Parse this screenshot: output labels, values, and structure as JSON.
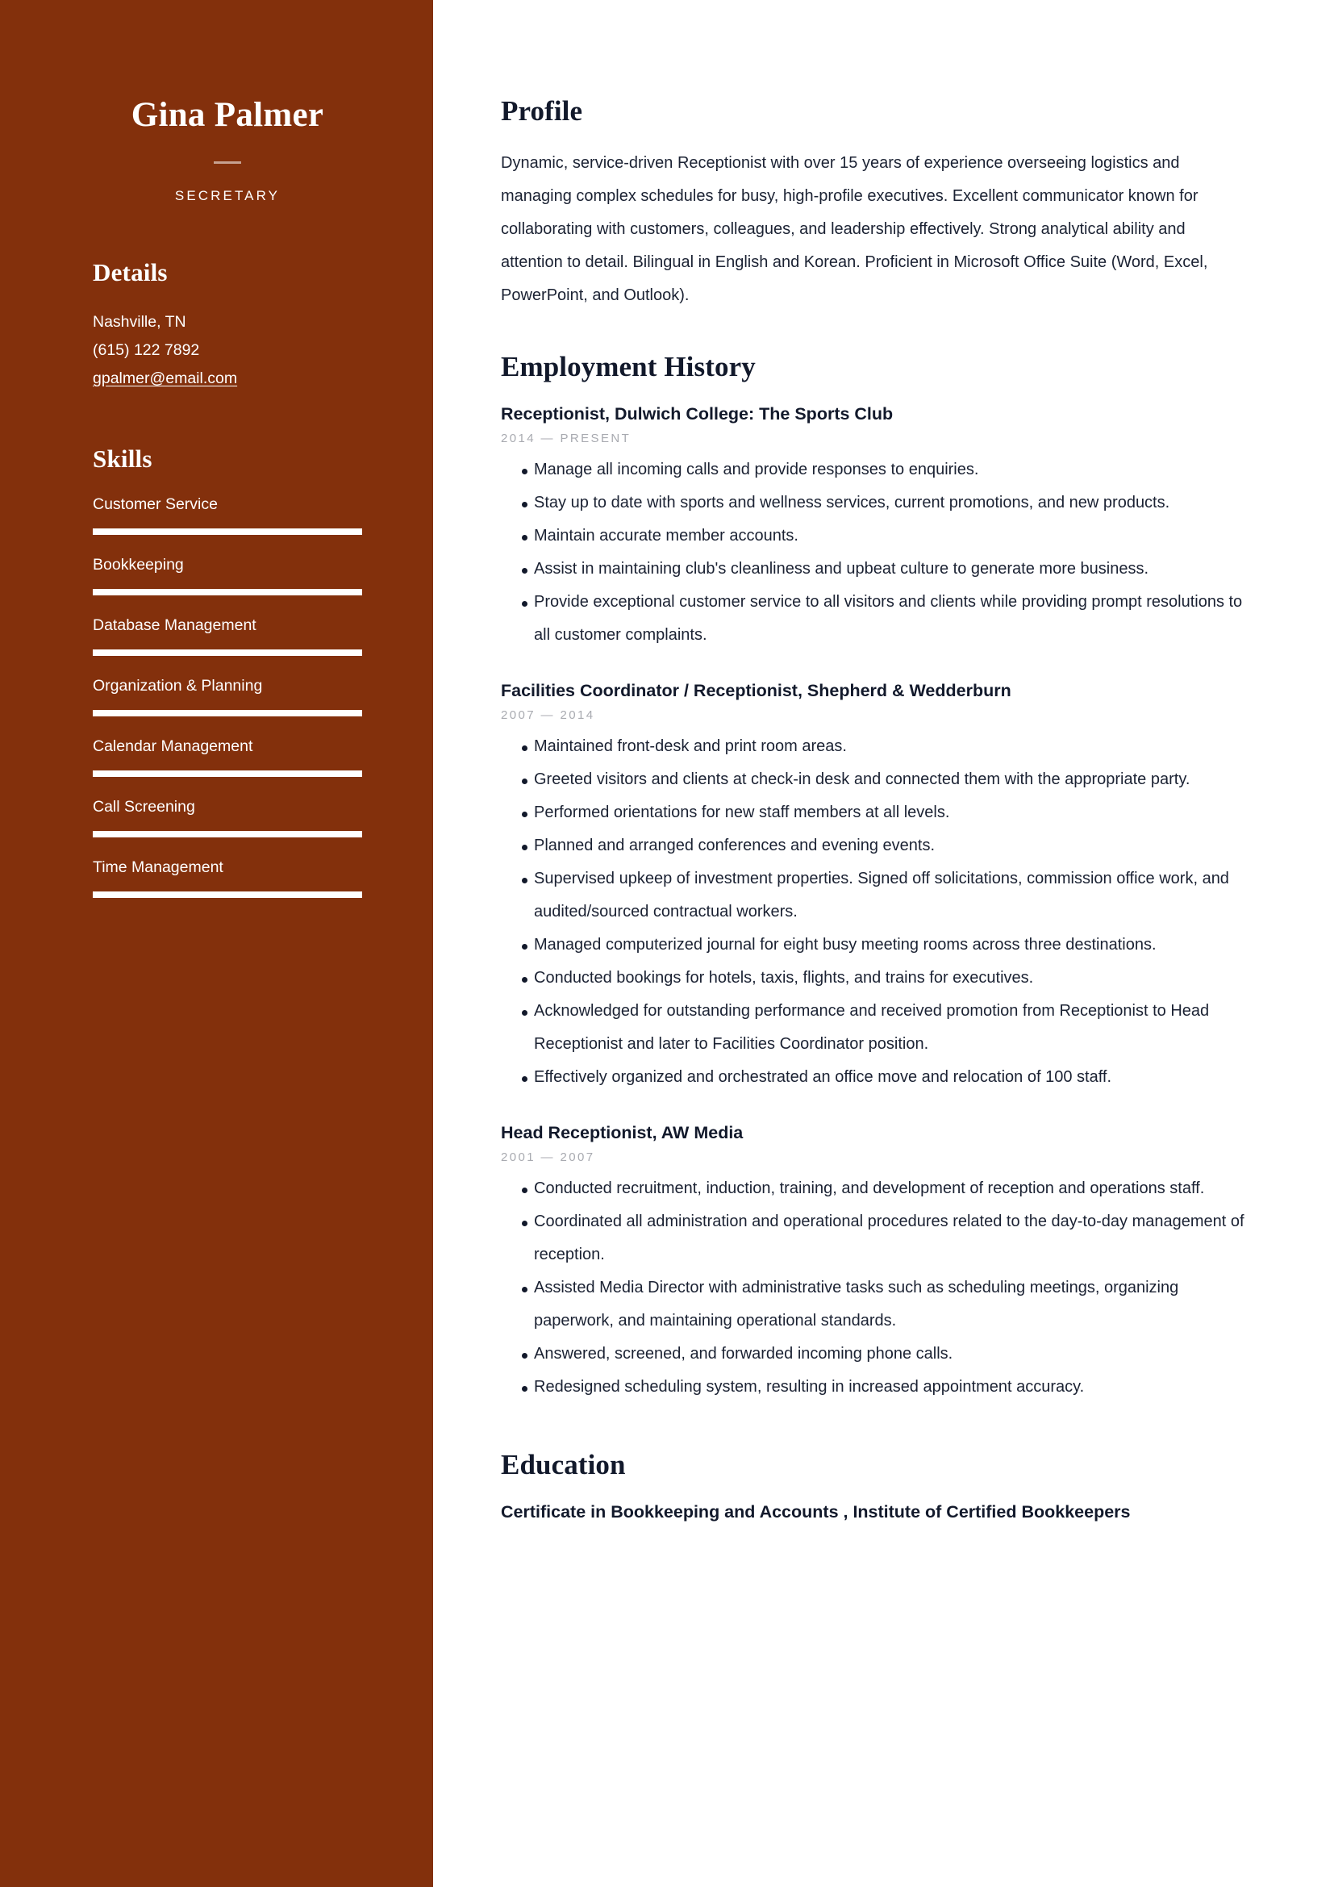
{
  "theme": {
    "sidebar_bg": "#83300C",
    "sidebar_text": "#FFFFFF",
    "main_text": "#12192B",
    "date_text": "#A8AAB0"
  },
  "sidebar": {
    "full_name": "Gina Palmer",
    "job_title": "SECRETARY",
    "details": {
      "heading": "Details",
      "lines": [
        {
          "text": "Nashville, TN",
          "is_link": false
        },
        {
          "text": "(615) 122 7892",
          "is_link": false
        },
        {
          "text": "gpalmer@email.com",
          "is_link": true
        }
      ]
    },
    "skills": {
      "heading": "Skills",
      "items": [
        {
          "label": "Customer Service",
          "level": 100
        },
        {
          "label": "Bookkeeping",
          "level": 100
        },
        {
          "label": "Database Management",
          "level": 100
        },
        {
          "label": "Organization & Planning",
          "level": 100
        },
        {
          "label": "Calendar Management",
          "level": 100
        },
        {
          "label": "Call Screening",
          "level": 100
        },
        {
          "label": "Time Management",
          "level": 100
        }
      ]
    }
  },
  "main": {
    "profile": {
      "heading": "Profile",
      "text": "Dynamic, service-driven Receptionist with over 15 years of experience overseeing logistics and managing complex schedules for busy, high-profile executives. Excellent communicator known for collaborating with customers, colleagues, and leadership effectively. Strong analytical ability and attention to detail. Bilingual in English and Korean. Proficient in Microsoft Office Suite (Word, Excel, PowerPoint, and Outlook)."
    },
    "employment": {
      "heading": "Employment History",
      "jobs": [
        {
          "title": "Receptionist, Dulwich College: The Sports Club",
          "dates": "2014 — PRESENT",
          "bullets": [
            "Manage all incoming calls and provide responses to enquiries.",
            "Stay up to date with sports and wellness services, current promotions, and new products.",
            "Maintain accurate member accounts.",
            "Assist in maintaining club's cleanliness and upbeat culture to generate more business.",
            "Provide exceptional customer service to all visitors and clients while providing prompt resolutions to all customer complaints."
          ]
        },
        {
          "title": "Facilities Coordinator / Receptionist, Shepherd & Wedderburn",
          "dates": "2007 — 2014",
          "bullets": [
            "Maintained front-desk and print room areas.",
            "Greeted visitors and clients at check-in desk and connected them with the appropriate party.",
            "Performed orientations for new staff members at all levels.",
            "Planned and arranged conferences and evening events.",
            "Supervised upkeep of investment properties. Signed off solicitations, commission office work, and audited/sourced contractual workers.",
            "Managed computerized journal for eight busy meeting rooms across three destinations.",
            "Conducted bookings for hotels, taxis, flights, and trains for executives.",
            "Acknowledged for outstanding performance and received promotion from Receptionist to Head Receptionist and later to Facilities Coordinator position.",
            "Effectively organized and orchestrated an office move and relocation of 100 staff."
          ]
        },
        {
          "title": "Head Receptionist, AW Media",
          "dates": "2001 — 2007",
          "bullets": [
            "Conducted recruitment, induction, training, and development of reception and operations staff.",
            "Coordinated all administration and operational procedures related to the day-to-day management of reception.",
            "Assisted Media Director with administrative tasks such as scheduling meetings, organizing paperwork, and maintaining operational standards.",
            "Answered, screened, and forwarded incoming phone calls.",
            "Redesigned scheduling system, resulting in increased appointment accuracy."
          ]
        }
      ]
    },
    "education": {
      "heading": "Education",
      "items": [
        "Certificate in Bookkeeping and Accounts , Institute of Certified Bookkeepers"
      ]
    }
  }
}
